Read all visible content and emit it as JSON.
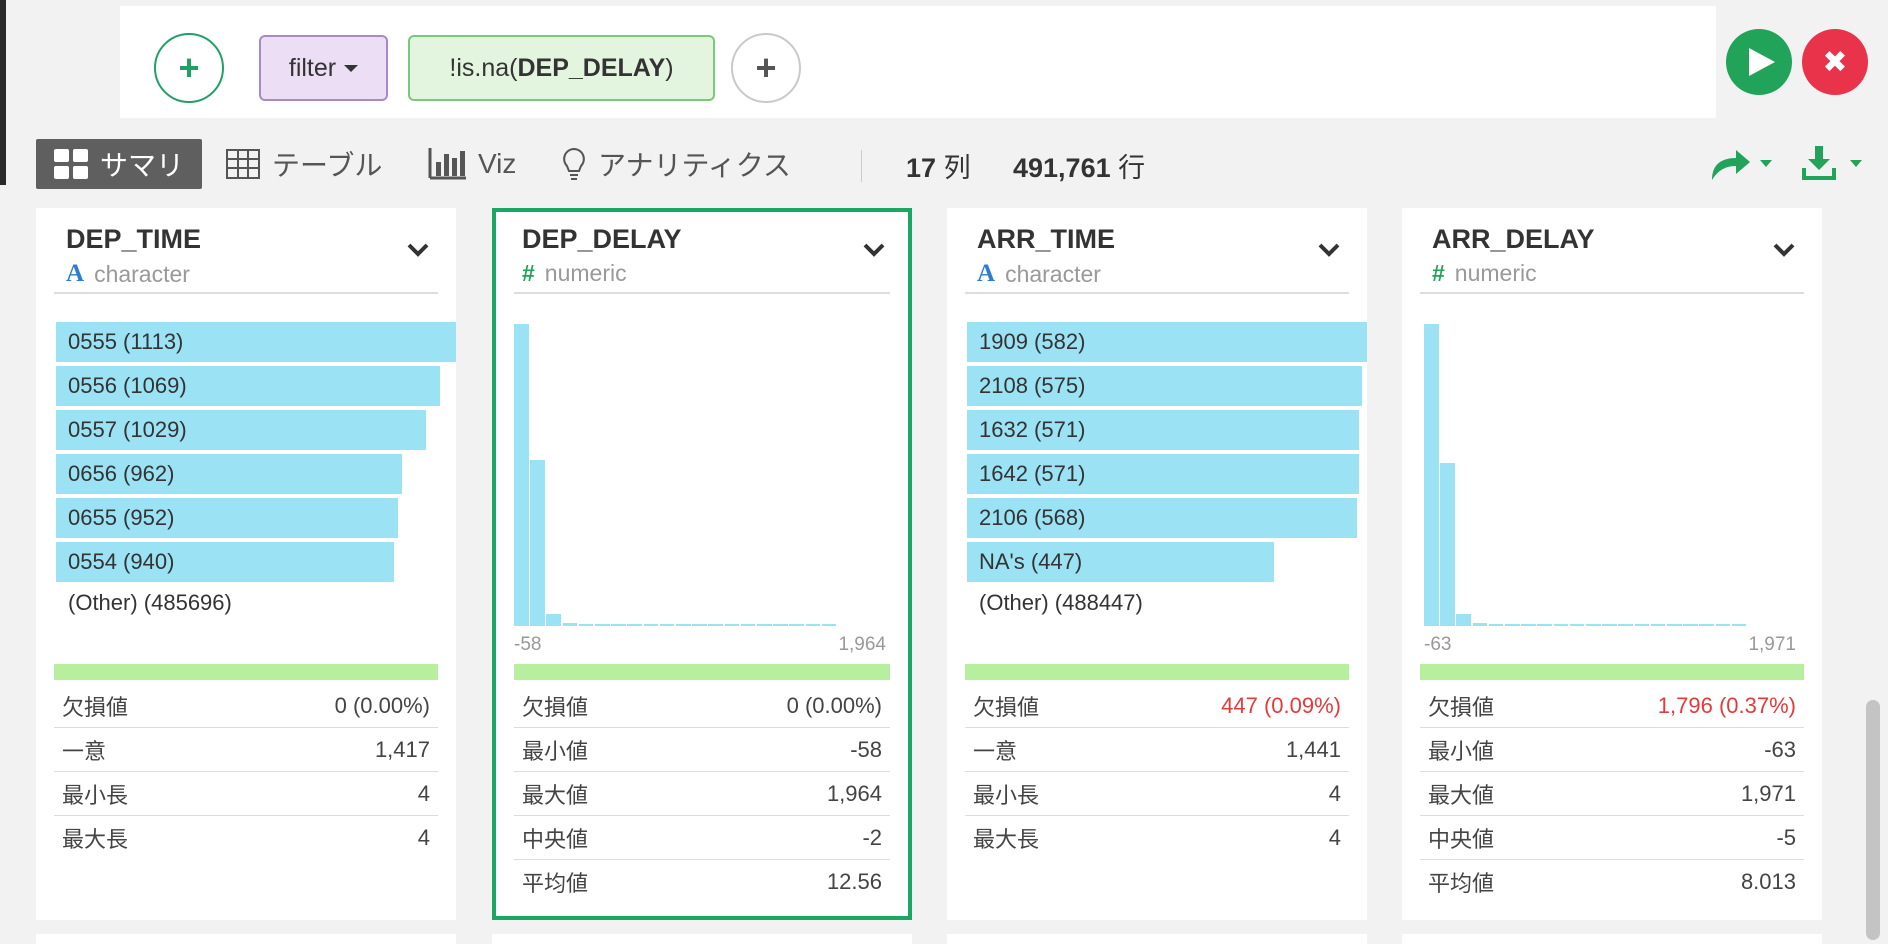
{
  "command": {
    "filter_label": "filter",
    "cond_prefix": "!is.na(",
    "cond_bold": "DEP_DELAY",
    "cond_suffix": ")"
  },
  "tabs": [
    {
      "label": "サマリ",
      "icon": "grid-icon"
    },
    {
      "label": "テーブル",
      "icon": "table-icon"
    },
    {
      "label": "Viz",
      "icon": "bar-chart-icon"
    },
    {
      "label": "アナリティクス",
      "icon": "lightbulb-icon"
    }
  ],
  "counts": {
    "columns": "17",
    "columns_unit": "列",
    "rows": "491,761",
    "rows_unit": "行"
  },
  "columns": [
    {
      "name": "DEP_TIME",
      "type": "character",
      "selected": false,
      "bars": [
        {
          "label": "0555 (1113)",
          "count": 1113
        },
        {
          "label": "0556 (1069)",
          "count": 1069
        },
        {
          "label": "0557 (1029)",
          "count": 1029
        },
        {
          "label": "0656 (962)",
          "count": 962
        },
        {
          "label": "0655 (952)",
          "count": 952
        },
        {
          "label": "0554 (940)",
          "count": 940
        }
      ],
      "other": "(Other) (485696)",
      "stats": [
        {
          "label": "欠損値",
          "value": "0 (0.00%)",
          "red": false
        },
        {
          "label": "一意",
          "value": "1,417",
          "red": false
        },
        {
          "label": "最小長",
          "value": "4",
          "red": false
        },
        {
          "label": "最大長",
          "value": "4",
          "red": false
        }
      ]
    },
    {
      "name": "DEP_DELAY",
      "type": "numeric",
      "selected": true,
      "hist": [
        1.0,
        0.55,
        0.04,
        0.01,
        0.005,
        0.005,
        0.005,
        0.005,
        0.005,
        0.005,
        0.005,
        0.005,
        0.005,
        0.005,
        0.005,
        0.005,
        0.005,
        0.005,
        0.005,
        0.005
      ],
      "hist_min": "-58",
      "hist_max": "1,964",
      "stats": [
        {
          "label": "欠損値",
          "value": "0 (0.00%)",
          "red": false
        },
        {
          "label": "最小値",
          "value": "-58",
          "red": false
        },
        {
          "label": "最大値",
          "value": "1,964",
          "red": false
        },
        {
          "label": "中央値",
          "value": "-2",
          "red": false
        },
        {
          "label": "平均値",
          "value": "12.56",
          "red": false
        }
      ]
    },
    {
      "name": "ARR_TIME",
      "type": "character",
      "selected": false,
      "bars": [
        {
          "label": "1909 (582)",
          "count": 582
        },
        {
          "label": "2108 (575)",
          "count": 575
        },
        {
          "label": "1632 (571)",
          "count": 571
        },
        {
          "label": "1642 (571)",
          "count": 571
        },
        {
          "label": "2106 (568)",
          "count": 568
        },
        {
          "label": "NA's (447)",
          "count": 447
        }
      ],
      "other": "(Other) (488447)",
      "stats": [
        {
          "label": "欠損値",
          "value": "447 (0.09%)",
          "red": true
        },
        {
          "label": "一意",
          "value": "1,441",
          "red": false
        },
        {
          "label": "最小長",
          "value": "4",
          "red": false
        },
        {
          "label": "最大長",
          "value": "4",
          "red": false
        }
      ]
    },
    {
      "name": "ARR_DELAY",
      "type": "numeric",
      "selected": false,
      "hist": [
        1.0,
        0.54,
        0.04,
        0.01,
        0.005,
        0.005,
        0.005,
        0.005,
        0.005,
        0.005,
        0.005,
        0.005,
        0.005,
        0.005,
        0.005,
        0.005,
        0.005,
        0.005,
        0.005,
        0.005
      ],
      "hist_min": "-63",
      "hist_max": "1,971",
      "stats": [
        {
          "label": "欠損値",
          "value": "1,796 (0.37%)",
          "red": true
        },
        {
          "label": "最小値",
          "value": "-63",
          "red": false
        },
        {
          "label": "最大値",
          "value": "1,971",
          "red": false
        },
        {
          "label": "中央値",
          "value": "-5",
          "red": false
        },
        {
          "label": "平均値",
          "value": "8.013",
          "red": false
        }
      ]
    }
  ]
}
